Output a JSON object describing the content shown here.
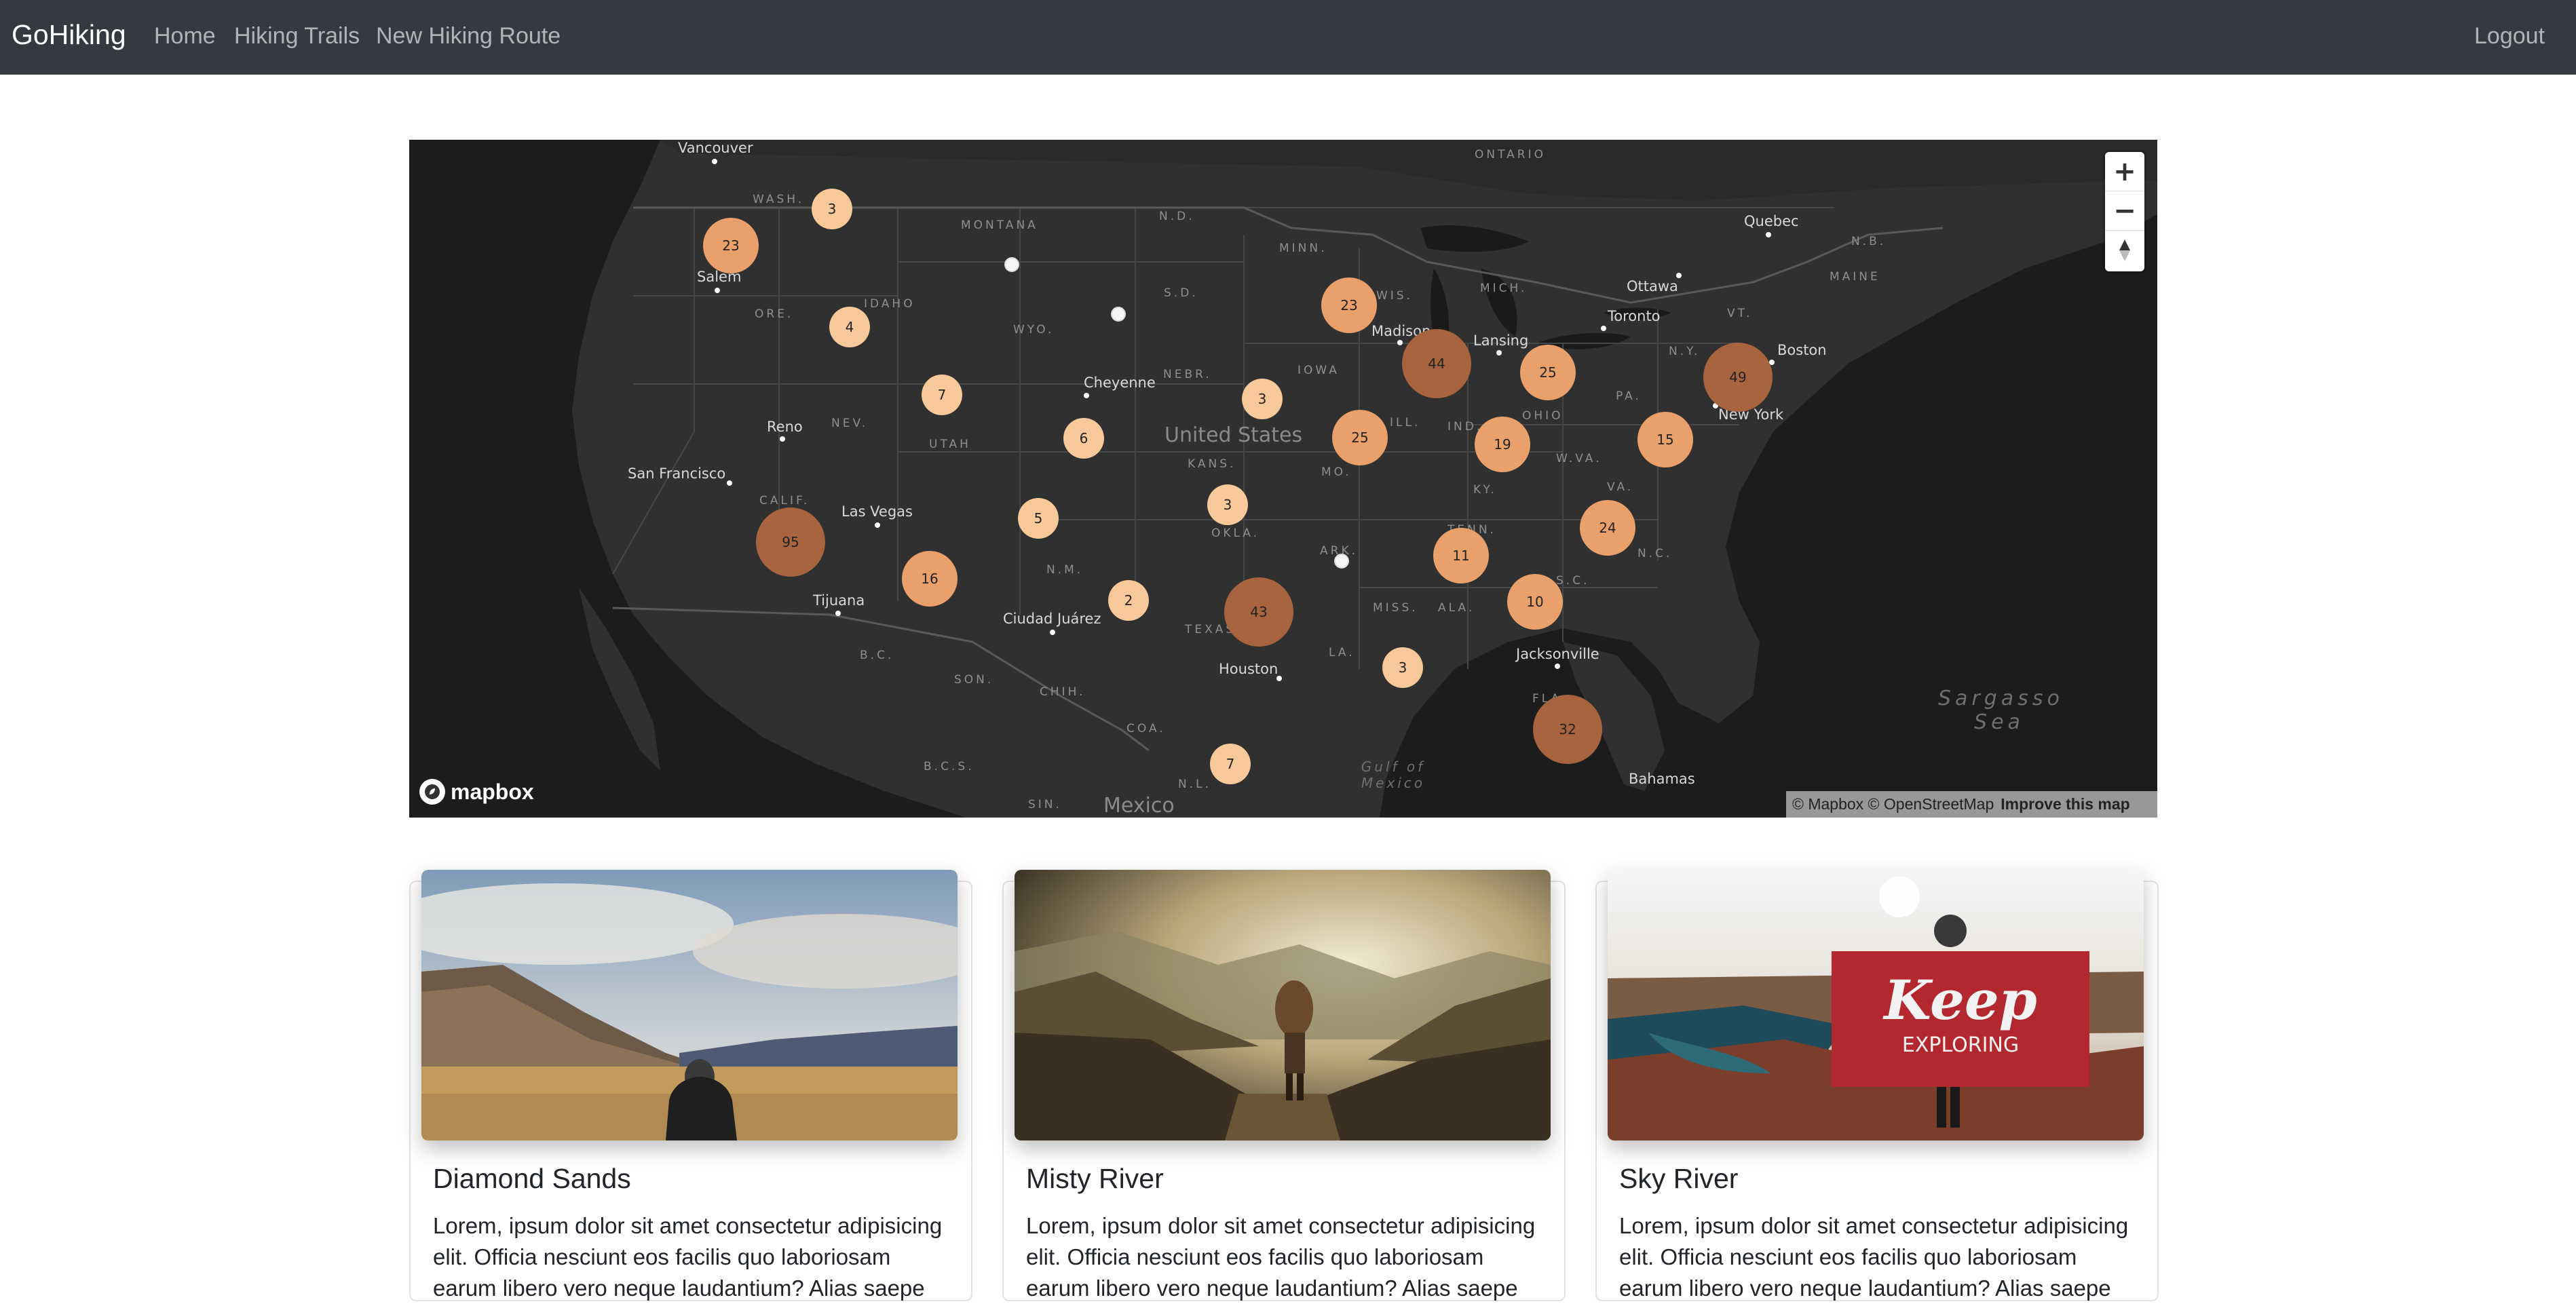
{
  "navbar": {
    "brand": "GoHiking",
    "links": [
      "Home",
      "Hiking Trails",
      "New Hiking Route"
    ],
    "logout": "Logout"
  },
  "map": {
    "city_labels": [
      "Vancouver",
      "Salem",
      "Reno",
      "San Francisco",
      "Las Vegas",
      "Tijuana",
      "Cheyenne",
      "Ciudad Juárez",
      "Houston",
      "Madison",
      "Lansing",
      "Toronto",
      "Ottawa",
      "Quebec",
      "Boston",
      "New York",
      "Jacksonville",
      "Bahamas"
    ],
    "state_labels": [
      "WASH.",
      "MONTANA",
      "N.D.",
      "MINN.",
      "ORE.",
      "IDAHO",
      "WYO.",
      "S.D.",
      "WIS.",
      "MICH.",
      "NEBR.",
      "IOWA",
      "NEV.",
      "UTAH",
      "KANS.",
      "MO.",
      "ILL.",
      "IND.",
      "OHIO",
      "PA.",
      "N.Y.",
      "VT.",
      "MAINE",
      "N.B.",
      "W.VA.",
      "VA.",
      "KY.",
      "TENN.",
      "S.C.",
      "N.C.",
      "ARK.",
      "OKLA.",
      "N.M.",
      "CALIF.",
      "TEXAS",
      "LA.",
      "MISS.",
      "ALA.",
      "FLA.",
      "B.C.",
      "SON.",
      "CHIH.",
      "COA.",
      "B.C.S.",
      "N.L.",
      "SIN.",
      "ONTARIO"
    ],
    "country_labels": [
      "United States",
      "Mexico"
    ],
    "water_labels": [
      "Sargasso Sea",
      "Gulf of Mexico"
    ],
    "clusters": [
      "3",
      "23",
      "4",
      "7",
      "6",
      "3",
      "23",
      "44",
      "25",
      "49",
      "25",
      "19",
      "15",
      "3",
      "5",
      "95",
      "16",
      "2",
      "43",
      "11",
      "24",
      "10",
      "3",
      "32",
      "7"
    ],
    "zoom_in": "+",
    "zoom_out": "−",
    "compass_icon": "compass-icon",
    "logo_text": "mapbox",
    "attribution": "© Mapbox © OpenStreetMap",
    "improve": "Improve this map"
  },
  "cards": [
    {
      "title": "Diamond Sands",
      "text": "Lorem, ipsum dolor sit amet consectetur adipisicing elit. Officia nesciunt eos facilis quo laboriosam earum libero vero neque laudantium? Alias saepe"
    },
    {
      "title": "Misty River",
      "text": "Lorem, ipsum dolor sit amet consectetur adipisicing elit. Officia nesciunt eos facilis quo laboriosam earum libero vero neque laudantium? Alias saepe"
    },
    {
      "title": "Sky River",
      "text": "Lorem, ipsum dolor sit amet consectetur adipisicing elit. Officia nesciunt eos facilis quo laboriosam earum libero vero neque laudantium? Alias saepe"
    }
  ],
  "card3_flag": {
    "top": "Keep",
    "bottom": "EXPLORING"
  },
  "colors": {
    "navbar": "#343a40",
    "map_bg": "#1c1c1c",
    "cluster_small": "#f6c89a",
    "cluster_medium": "#e9a06b",
    "cluster_large": "#a8643e"
  }
}
